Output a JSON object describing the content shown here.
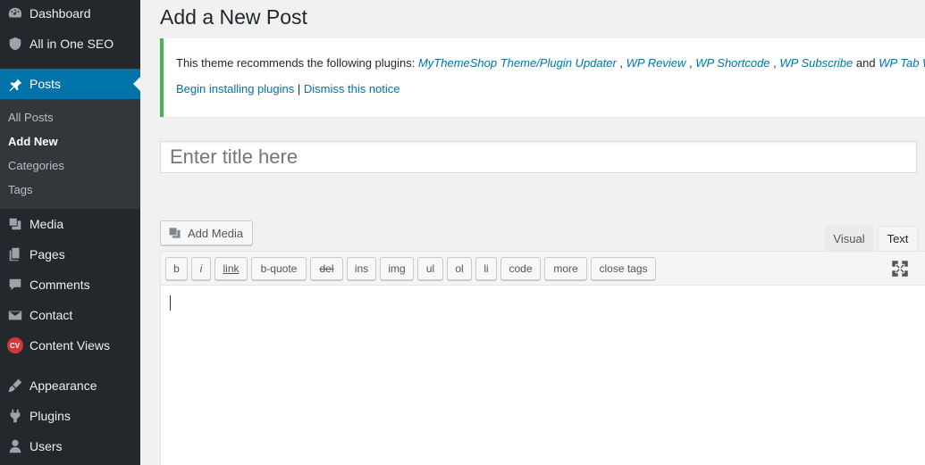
{
  "sidebar": {
    "items": [
      {
        "label": "Dashboard",
        "icon": "dashboard-icon"
      },
      {
        "label": "All in One SEO",
        "icon": "shield-icon"
      },
      {
        "label": "Posts",
        "icon": "pin-icon"
      },
      {
        "label": "Media",
        "icon": "media-icon"
      },
      {
        "label": "Pages",
        "icon": "pages-icon"
      },
      {
        "label": "Comments",
        "icon": "comments-icon"
      },
      {
        "label": "Contact",
        "icon": "mail-icon"
      },
      {
        "label": "Content Views",
        "icon": "cv-icon",
        "badge": "CV"
      },
      {
        "label": "Appearance",
        "icon": "brush-icon"
      },
      {
        "label": "Plugins",
        "icon": "plugin-icon"
      },
      {
        "label": "Users",
        "icon": "user-icon"
      }
    ],
    "submenu": [
      {
        "label": "All Posts"
      },
      {
        "label": "Add New"
      },
      {
        "label": "Categories"
      },
      {
        "label": "Tags"
      }
    ]
  },
  "page": {
    "title": "Add a New Post"
  },
  "notice": {
    "prefix": "This theme recommends the following plugins: ",
    "plugins": [
      "MyThemeShop Theme/Plugin Updater",
      "WP Review",
      "WP Shortcode",
      "WP Subscribe",
      "WP Tab Widget"
    ],
    "and": " and ",
    "separator": " , ",
    "begin_link": "Begin installing plugins",
    "pipe": " | ",
    "dismiss_link": "Dismiss this notice"
  },
  "editor": {
    "title_placeholder": "Enter title here",
    "add_media_label": "Add Media",
    "tabs": {
      "visual": "Visual",
      "text": "Text"
    },
    "quicktags": [
      "b",
      "i",
      "link",
      "b-quote",
      "del",
      "ins",
      "img",
      "ul",
      "ol",
      "li",
      "code",
      "more",
      "close tags"
    ]
  },
  "colors": {
    "sidebar_bg": "#23282d",
    "accent": "#0073aa",
    "notice_border": "#46b450"
  }
}
